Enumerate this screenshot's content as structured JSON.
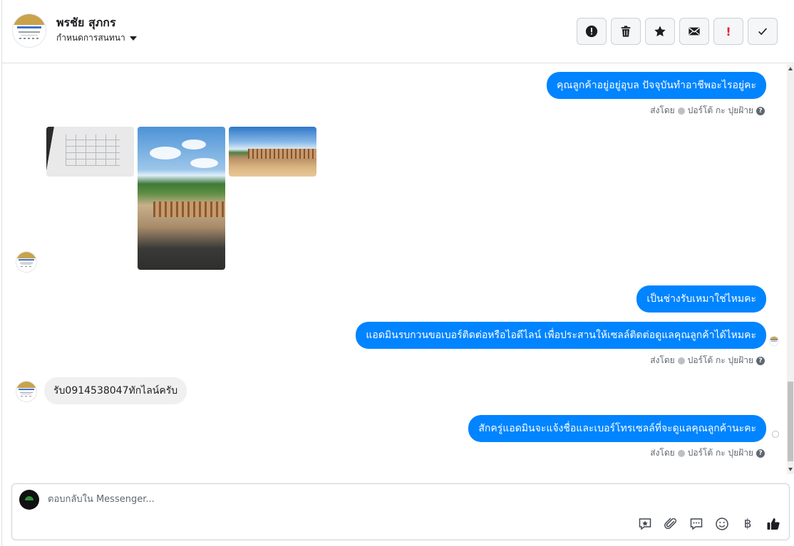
{
  "header": {
    "name": "พรชัย สุภกร",
    "subtitle": "กำหนดการสนทนา",
    "actions": [
      {
        "label": "",
        "icon": "alert-circle-icon"
      },
      {
        "label": "",
        "icon": "trash-icon"
      },
      {
        "label": "",
        "icon": "star-icon"
      },
      {
        "label": "",
        "icon": "envelope-icon"
      },
      {
        "label": "!",
        "icon": "important-icon"
      },
      {
        "label": "",
        "icon": "check-icon"
      }
    ]
  },
  "messages": {
    "m1": "คุณลูกค้าอยู่อยู่อุบล ปัจจุบันทำอาชีพอะไรอยู่คะ",
    "m2": "เป็นช่างรับเหมาใช่ไหมคะ",
    "m3": "แอดมินรบกวนขอเบอร์ติดต่อหรือไอดีไลน์ เพื่อประสานให้เซลล์ติดต่อดูแลคุณลูกค้าได้ไหมคะ",
    "m4": "รับ0914538047ทักไลน์ครับ",
    "m5": "สักครู่แอดมินจะแจ้งชื่อและเบอร์โทรเซลล์ที่จะดูแลคุณลูกค้านะคะ"
  },
  "sent_by": {
    "prefix": "ส่งโดย",
    "name": "ปอร์โต้ กะ ปุยฝ้าย",
    "help": "?"
  },
  "composer": {
    "placeholder": "ตอบกลับใน Messenger...",
    "baht": "฿"
  },
  "colors": {
    "accent": "#0084ff",
    "incoming": "#f1f0f0",
    "important": "#e41e3f"
  }
}
